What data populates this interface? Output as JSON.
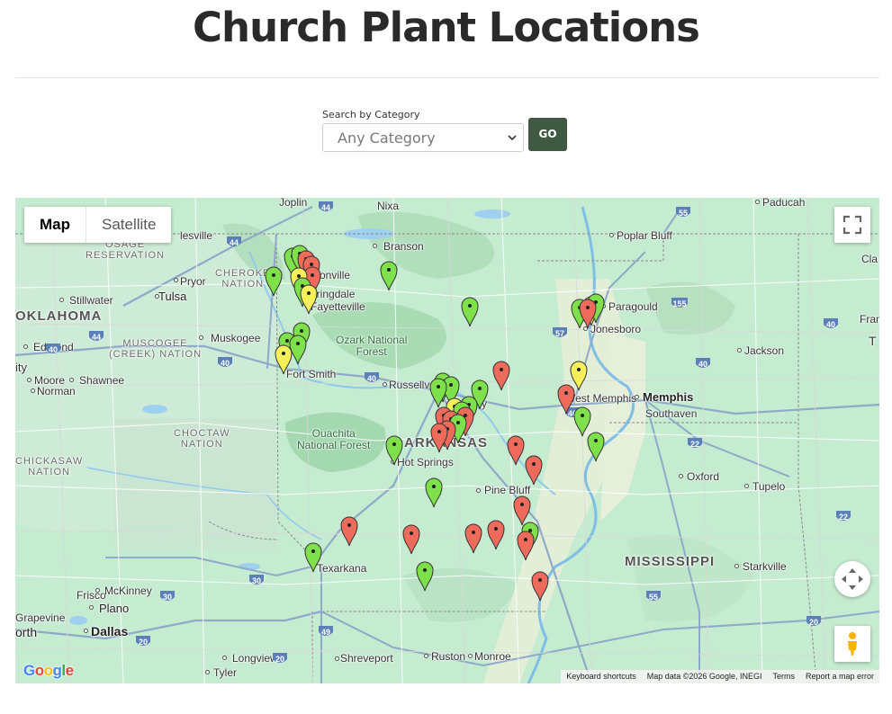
{
  "page": {
    "title": "Church Plant Locations",
    "search_label": "Search by Category",
    "category_select": {
      "value": "Any Category"
    },
    "go_label": "GO"
  },
  "map": {
    "map_type_active": "Map",
    "map_type_other": "Satellite",
    "attribution": {
      "keyboard": "Keyboard shortcuts",
      "data": "Map data ©2026 Google, INEGI",
      "terms": "Terms",
      "report": "Report a map error"
    },
    "logo": "Google",
    "marker_colors": {
      "green": "#7ee04a",
      "red": "#ee6b5c",
      "yellow": "#f5f05a"
    },
    "labels": {
      "joplin": "Joplin",
      "nixa": "Nixa",
      "paducah": "Paducah",
      "bartlesville": "lesville",
      "branson": "Branson",
      "poplar_bluff": "Poplar Bluff",
      "osage": "OSAGE\nRESERVATION",
      "cherokee": "CHEROKE\nNATION",
      "bentonville": "ntonville",
      "pryor": "Pryor",
      "stillwater": "Stillwater",
      "tulsa": "Tulsa",
      "springdale": "Springdale",
      "fayetteville": "Fayetteville",
      "paragould": "Paragould",
      "oklahoma": "OKLAHOMA",
      "jonesboro": "Jonesboro",
      "muskogee": "Muskogee",
      "ozark": "Ozark National\nForest",
      "muscogee": "MUSCOGEE\n(CREEK) NATION",
      "edmond": "Edmond",
      "jackson": "Jackson",
      "fort_smith": "Fort Smith",
      "city_cut": "ity",
      "moore": "Moore",
      "shawnee": "Shawnee",
      "russellville": "Russellv",
      "norman": "Norman",
      "west_memphis": "West Memphis",
      "memphis": "Memphis",
      "southaven": "Southaven",
      "choctaw": "CHOCTAW\nNATION",
      "ouachita": "Ouachita\nNational Forest",
      "arkansas": "ARKANSAS",
      "chickasaw": "CHICKASAW\nNATION",
      "hot_springs": "Hot Springs",
      "oxford": "Oxford",
      "tupelo": "Tupelo",
      "pine_bluff": "Pine Bluff",
      "mississippi": "MISSISSIPPI",
      "texarkana": "Texarkana",
      "starkville": "Starkville",
      "frisco": "Frisco",
      "mckinney": "McKinney",
      "plano": "Plano",
      "grapevine": "Grapevine",
      "dallas": "Dallas",
      "north_cut": "orth",
      "longview": "Longview",
      "tyler": "Tyler",
      "shreveport": "Shreveport",
      "ruston": "Ruston",
      "monroe": "Monroe",
      "frankfort_cut": "Fran",
      "cla_cut": "Cla",
      "t_cut": "T",
      "conway_cut": "y"
    },
    "shields": {
      "i44a": "44",
      "i44b": "44",
      "i44c": "44",
      "i55a": "55",
      "i57": "57",
      "i155": "155",
      "i40a": "40",
      "i40b": "40",
      "i40c": "40",
      "i40d": "40",
      "i40e": "40",
      "i40f": "40",
      "i22a": "22",
      "i22b": "22",
      "i30a": "30",
      "i30b": "30",
      "i20a": "20",
      "i20b": "20",
      "i20c": "20",
      "i49": "49",
      "i55b": "55"
    }
  }
}
